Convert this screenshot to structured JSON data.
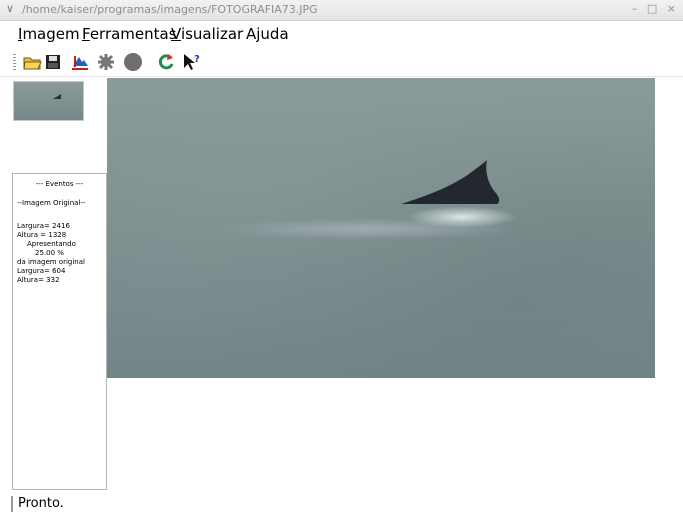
{
  "window": {
    "title": "/home/kaiser/programas/imagens/FOTOGRAFIA73.JPG",
    "menu_glyph": "∨",
    "controls_glyph": "– □ ×"
  },
  "menu": {
    "items": [
      {
        "first": "I",
        "rest": "magem"
      },
      {
        "first": "F",
        "rest": "erramentas"
      },
      {
        "first": "V",
        "rest": "isualizar"
      },
      {
        "first": "",
        "rest": "Ajuda"
      }
    ]
  },
  "toolbar": {
    "icons": [
      "open-folder-icon",
      "save-disk-icon",
      "crop-image-icon",
      "filter-gear-icon",
      "circle-icon",
      "refresh-icon",
      "help-pointer-icon"
    ]
  },
  "events": {
    "lines": [
      "--- Eventos ---",
      "--Imagem Original--",
      "Largura= 2416",
      "Altura = 1328",
      "Apresentando",
      "25.00 %",
      "da imagem original",
      "Largura= 604",
      "Altura= 332"
    ]
  },
  "status": {
    "text": "Pronto."
  },
  "colors": {
    "water": "#7d8f8f",
    "fin": "#23282e",
    "titlebar_text": "#8e8e8e"
  }
}
